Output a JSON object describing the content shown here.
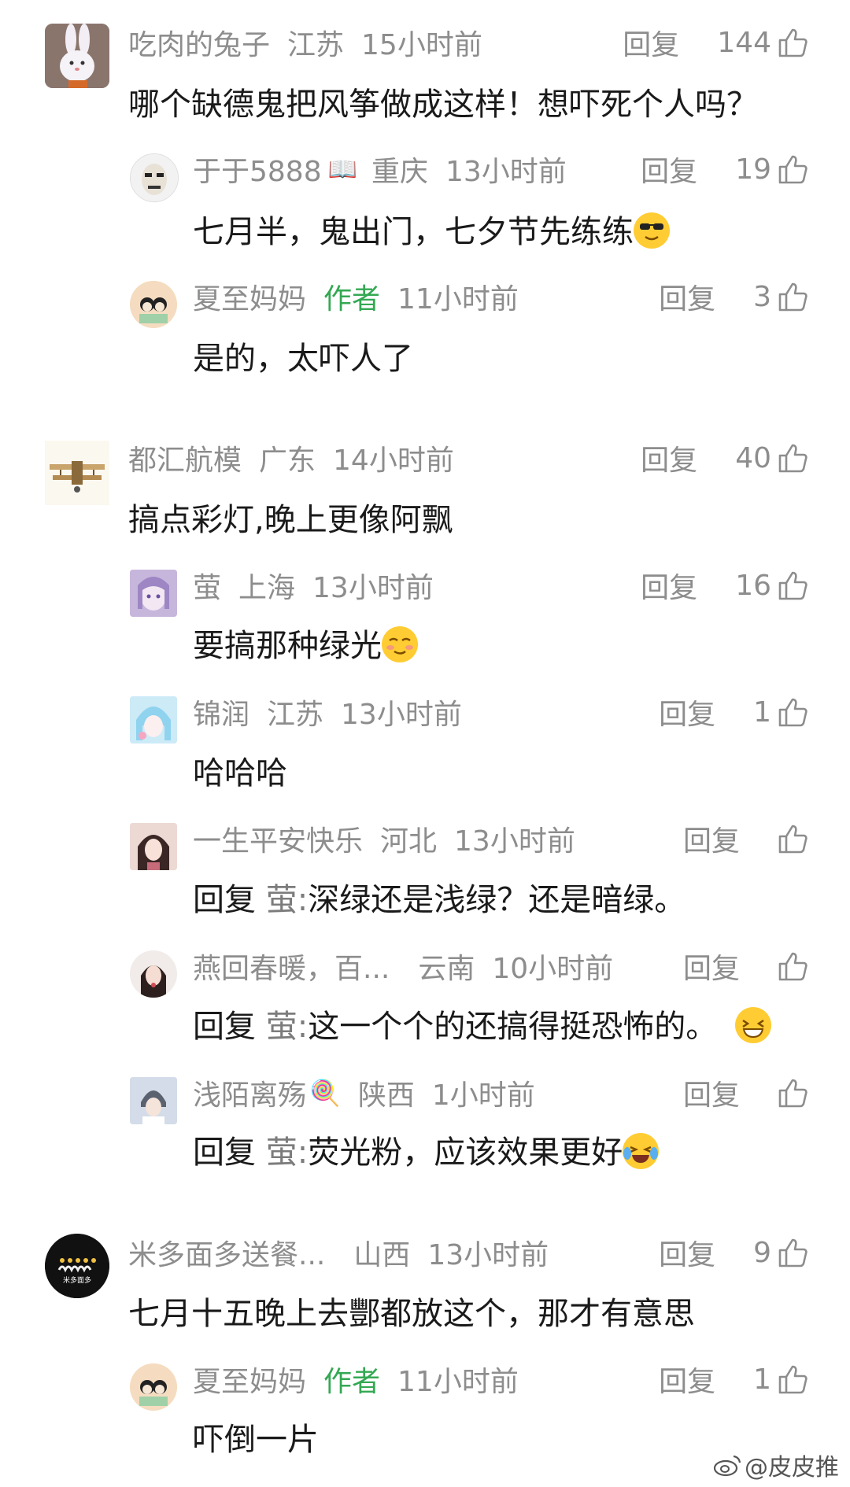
{
  "reply_label": "回复",
  "comments": [
    {
      "name": "吃肉的兔子",
      "region": "江苏",
      "time": "15小时前",
      "likes": "144",
      "text": "哪个缺德鬼把风筝做成这样！想吓死个人吗？"
    },
    {
      "name": "于于5888",
      "region": "重庆",
      "time": "13小时前",
      "likes": "19",
      "text": "七月半，鬼出门，七夕节先练练",
      "emoji": "sunglasses-emoji"
    },
    {
      "name": "夏至妈妈",
      "badge": "作者",
      "time": "11小时前",
      "likes": "3",
      "text": "是的，太吓人了"
    },
    {
      "name": "都汇航模",
      "region": "广东",
      "time": "14小时前",
      "likes": "40",
      "text": "搞点彩灯,晚上更像阿飘"
    },
    {
      "name": "萤",
      "region": "上海",
      "time": "13小时前",
      "likes": "16",
      "text": "要搞那种绿光",
      "emoji": "smirk-emoji"
    },
    {
      "name": "锦润",
      "region": "江苏",
      "time": "13小时前",
      "likes": "1",
      "text": "哈哈哈"
    },
    {
      "name": "一生平安快乐",
      "region": "河北",
      "time": "13小时前",
      "likes": "",
      "reply_prefix": "回复",
      "reply_target": "萤:",
      "text": "深绿还是浅绿？还是暗绿。"
    },
    {
      "name": "燕回春暖，百...",
      "region": "云南",
      "time": "10小时前",
      "likes": "",
      "reply_prefix": "回复",
      "reply_target": "萤:",
      "text": "这一个个的还搞得挺恐怖的。",
      "emoji": "grin-emoji"
    },
    {
      "name": "浅陌离殇",
      "region": "陕西",
      "time": "1小时前",
      "likes": "",
      "reply_prefix": "回复",
      "reply_target": "萤:",
      "text": "荧光粉，应该效果更好",
      "emoji": "laugh-cry-emoji"
    },
    {
      "name": "米多面多送餐...",
      "region": "山西",
      "time": "13小时前",
      "likes": "9",
      "text": "七月十五晚上去酆都放这个，那才有意思"
    },
    {
      "name": "夏至妈妈",
      "badge": "作者",
      "time": "11小时前",
      "likes": "1",
      "text": "吓倒一片"
    }
  ],
  "avatar_logo_text": "米多面多",
  "watermark": "@皮皮推",
  "colors": {
    "meta": "#8d8d8d",
    "text": "#1a1a1a",
    "author_badge": "#34a853",
    "vip_badge": "#4e8fd8"
  }
}
